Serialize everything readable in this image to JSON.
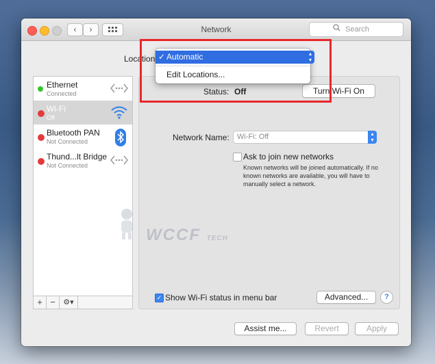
{
  "window": {
    "title": "Network"
  },
  "toolbar": {
    "back_icon": "‹",
    "forward_icon": "›",
    "search_placeholder": "Search"
  },
  "location": {
    "label": "Location:",
    "selected": "Automatic",
    "check": "✓",
    "menu_items": [
      "Automatic",
      "Edit Locations..."
    ]
  },
  "services": [
    {
      "name": "Ethernet",
      "status": "Connected",
      "dot": "green",
      "icon": "ethernet-icon"
    },
    {
      "name": "Wi-Fi",
      "status": "Off",
      "dot": "red",
      "icon": "wifi-icon"
    },
    {
      "name": "Bluetooth PAN",
      "status": "Not Connected",
      "dot": "red",
      "icon": "bluetooth-icon"
    },
    {
      "name": "Thund...lt Bridge",
      "status": "Not Connected",
      "dot": "red",
      "icon": "thunderbolt-bridge-icon"
    }
  ],
  "sidebar_buttons": {
    "add": "+",
    "remove": "−",
    "gear": "⚙▾"
  },
  "status": {
    "label": "Status:",
    "value": "Off",
    "turn_on_button": "Turn Wi-Fi On"
  },
  "network_name": {
    "label": "Network Name:",
    "value": "Wi-Fi: Off"
  },
  "ask_join": {
    "label": "Ask to join new networks",
    "checked": false,
    "help": "Known networks will be joined automatically. If no known networks are available, you will have to manually select a network."
  },
  "show_wifi_status": {
    "label": "Show Wi-Fi status in menu bar",
    "checked": true
  },
  "buttons": {
    "advanced": "Advanced...",
    "help": "?",
    "assist": "Assist me...",
    "revert": "Revert",
    "apply": "Apply"
  },
  "watermark": {
    "text": "WCCF",
    "small": "TECH"
  },
  "colors": {
    "accent": "#2f6de1",
    "highlight_box": "#e8262a",
    "connected": "#37c431",
    "disconnected": "#e53a3a"
  }
}
